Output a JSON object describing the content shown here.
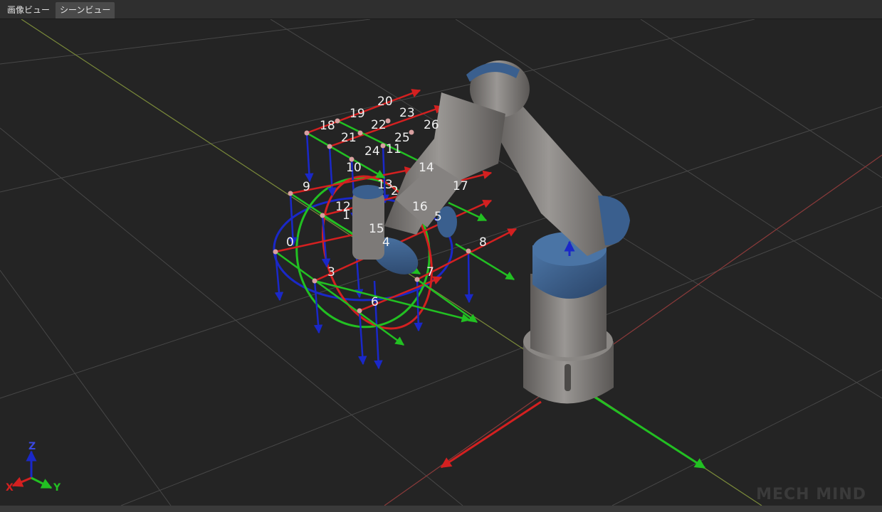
{
  "tabs": [
    {
      "label": "画像ビュー",
      "active": false
    },
    {
      "label": "シーンビュー",
      "active": true
    }
  ],
  "scene": {
    "point_labels": [
      "0",
      "1",
      "2",
      "3",
      "4",
      "5",
      "6",
      "7",
      "8",
      "9",
      "10",
      "11",
      "12",
      "13",
      "14",
      "15",
      "16",
      "17",
      "18",
      "19",
      "20",
      "21",
      "22",
      "23",
      "24",
      "25",
      "26"
    ],
    "axis_indicator": {
      "x": "X",
      "y": "Y",
      "z": "Z"
    },
    "colors": {
      "x_axis": "#d42020",
      "y_axis": "#22c022",
      "z_axis": "#1a28c8",
      "grid": "#4a4a4a",
      "robot_body": "#7d7a78",
      "robot_cap": "#3a5f8e"
    }
  },
  "watermark": "MECH MIND"
}
